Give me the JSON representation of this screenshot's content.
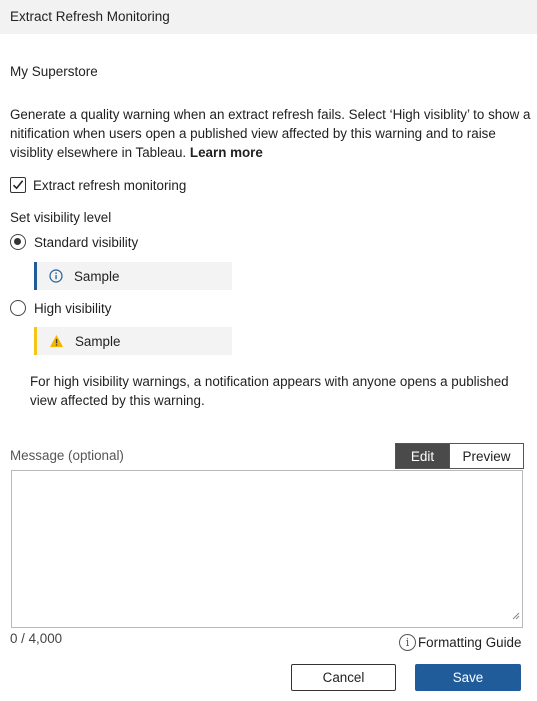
{
  "dialog": {
    "title": "Extract Refresh Monitoring",
    "datasource_name": "My Superstore",
    "description": "Generate a quality warning when an extract refresh fails. Select ‘High visiblity’ to show a nitification when users open a published view affected by this warning and to raise visiblity elsewhere in Tableau.",
    "learn_more": "Learn more",
    "monitoring_checkbox": {
      "label": "Extract refresh monitoring",
      "checked": true
    },
    "visibility": {
      "heading": "Set visibility level",
      "selected": "standard",
      "standard": {
        "label": "Standard visibility",
        "sample_text": "Sample",
        "accent_color": "#1f5c99",
        "icon": "info-icon"
      },
      "high": {
        "label": "High visibility",
        "sample_text": "Sample",
        "accent_color": "#f5c518",
        "icon": "warning-icon"
      }
    },
    "high_visibility_note": "For high visibility warnings, a notification appears with anyone opens a published view affected by this warning.",
    "message": {
      "label": "Message (optional)",
      "value": "",
      "tabs": {
        "edit": "Edit",
        "preview": "Preview",
        "active": "Edit"
      },
      "counter": "0 / 4,000",
      "formatting_guide": "Formatting Guide"
    },
    "buttons": {
      "cancel": "Cancel",
      "save": "Save",
      "primary_color": "#1f5c99"
    }
  }
}
